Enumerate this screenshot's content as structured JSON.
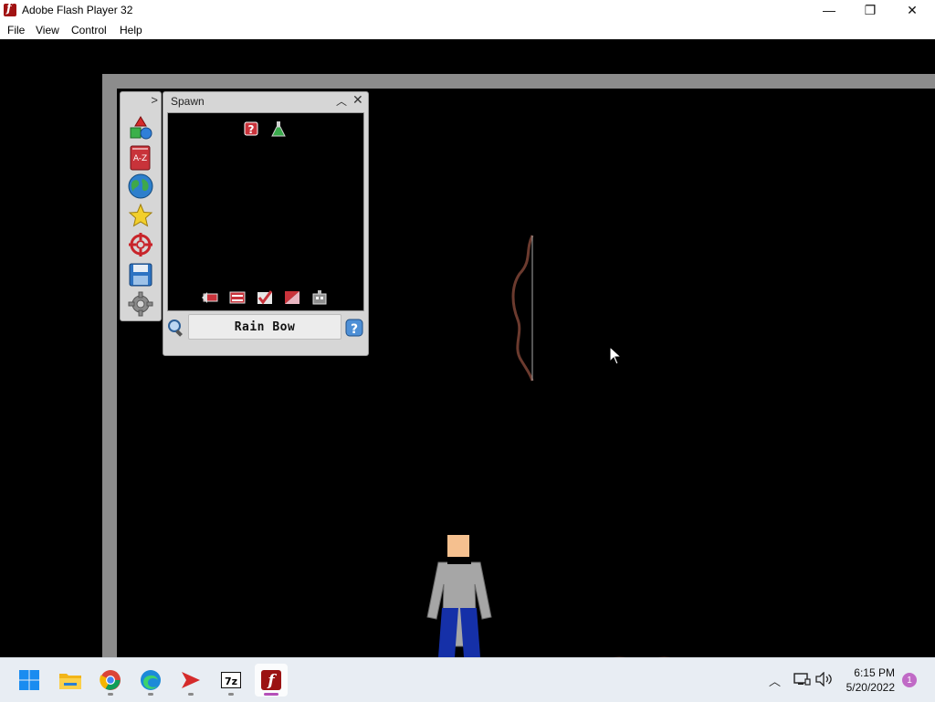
{
  "window": {
    "title": "Adobe Flash Player 32",
    "minimize_glyph": "—",
    "maximize_glyph": "❐",
    "close_glyph": "✕"
  },
  "menu": {
    "items": [
      {
        "label": "File"
      },
      {
        "label": "View"
      },
      {
        "label": "Control"
      },
      {
        "label": "Help"
      }
    ]
  },
  "toolbar": {
    "tools": [
      {
        "icon": "shapes-icon"
      },
      {
        "icon": "a-z-icon",
        "label": "A-Z"
      },
      {
        "icon": "globe-icon"
      },
      {
        "icon": "star-icon"
      },
      {
        "icon": "target-icon"
      },
      {
        "icon": "save-icon"
      },
      {
        "icon": "settings-icon"
      }
    ]
  },
  "spawn_panel": {
    "title": "Spawn",
    "search_value": "Rain Bow",
    "items": [
      {
        "icon": "mystery-item-icon"
      },
      {
        "icon": "potion-flask-icon"
      }
    ],
    "sub_tools": [
      {
        "icon": "back-icon"
      },
      {
        "icon": "sliders-icon"
      },
      {
        "icon": "check-icon"
      },
      {
        "icon": "color-swatch-icon"
      },
      {
        "icon": "robot-icon"
      }
    ]
  },
  "taskbar": {
    "apps": [
      {
        "icon": "windows-start-icon"
      },
      {
        "icon": "file-explorer-icon"
      },
      {
        "icon": "chrome-icon"
      },
      {
        "icon": "edge-icon"
      },
      {
        "icon": "send-app-icon"
      },
      {
        "icon": "7zip-icon",
        "label": "7z"
      },
      {
        "icon": "flash-player-icon"
      }
    ],
    "clock_time": "6:15 PM",
    "clock_date": "5/20/2022",
    "notification_count": "1"
  },
  "colors": {
    "stage_background": "#000000",
    "wall": "#8c8c8c",
    "panel": "#d6d6d6",
    "ragdoll_shirt": "#a6a6a6",
    "ragdoll_pants": "#1530a8",
    "ragdoll_skin": "#f5c08f"
  }
}
